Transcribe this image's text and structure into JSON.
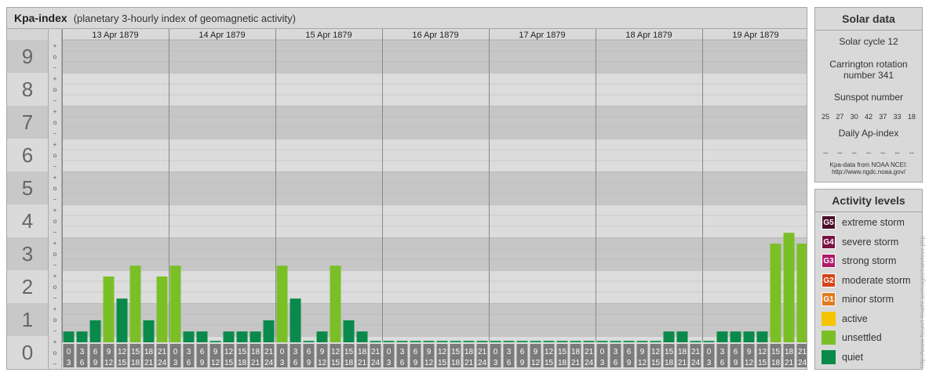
{
  "header": {
    "title": "Kpa-index",
    "subtitle": "(planetary 3-hourly index of geomagnetic activity)"
  },
  "chart_data": {
    "type": "bar",
    "title": "Kpa-index",
    "y_levels": [
      "0",
      "1",
      "2",
      "3",
      "4",
      "5",
      "6",
      "7",
      "8",
      "9"
    ],
    "y_sublevels": [
      "+",
      "o",
      "−"
    ],
    "ylim": [
      0,
      9
    ],
    "days": [
      "13 Apr 1879",
      "14 Apr 1879",
      "15 Apr 1879",
      "16 Apr 1879",
      "17 Apr 1879",
      "18 Apr 1879",
      "19 Apr 1879"
    ],
    "hour_start": [
      "0",
      "3",
      "6",
      "9",
      "12",
      "15",
      "18",
      "21"
    ],
    "hour_end": [
      "3",
      "6",
      "9",
      "12",
      "15",
      "18",
      "21",
      "24"
    ],
    "values": [
      [
        0.33,
        0.33,
        0.67,
        2.0,
        1.33,
        2.33,
        0.67,
        2.0
      ],
      [
        2.33,
        0.33,
        0.33,
        0.0,
        0.33,
        0.33,
        0.33,
        0.67
      ],
      [
        2.33,
        1.33,
        0.0,
        0.33,
        2.33,
        0.67,
        0.33,
        0.0
      ],
      [
        0.0,
        0.0,
        0.0,
        0.0,
        0.0,
        0.0,
        0.0,
        0.0
      ],
      [
        0.0,
        0.0,
        0.0,
        0.0,
        0.0,
        0.0,
        0.0,
        0.0
      ],
      [
        0.0,
        0.0,
        0.0,
        0.0,
        0.0,
        0.33,
        0.33,
        0.0
      ],
      [
        0.0,
        0.33,
        0.33,
        0.33,
        0.33,
        3.0,
        3.33,
        3.0
      ]
    ],
    "colors": {
      "quiet": "#0a8a4a",
      "unsettled": "#7bbf27",
      "zero": "#1f9b57"
    }
  },
  "solar": {
    "heading": "Solar data",
    "cycle": "Solar cycle 12",
    "carrington_line1": "Carrington rotation",
    "carrington_line2": "number 341",
    "sunspot_label": "Sunspot number",
    "sunspots": [
      "25",
      "27",
      "30",
      "42",
      "37",
      "33",
      "18"
    ],
    "ap_label": "Daily Ap-index",
    "ap_values": [
      "--",
      "--",
      "--",
      "--",
      "--",
      "--",
      "--"
    ],
    "credit_line1": "Kpa-data from NOAA NCEI:",
    "credit_line2": "http://www.ngdc.noaa.gov/"
  },
  "activity": {
    "heading": "Activity levels",
    "levels": [
      {
        "badge": "G5",
        "label": "extreme storm",
        "color": "#4d0f2a"
      },
      {
        "badge": "G4",
        "label": "severe storm",
        "color": "#7a1446"
      },
      {
        "badge": "G3",
        "label": "strong storm",
        "color": "#b0196a"
      },
      {
        "badge": "G2",
        "label": "moderate storm",
        "color": "#d64319"
      },
      {
        "badge": "G1",
        "label": "minor storm",
        "color": "#e07b1c"
      },
      {
        "badge": "",
        "label": "active",
        "color": "#f5c400"
      },
      {
        "badge": "",
        "label": "unsettled",
        "color": "#7bbf27"
      },
      {
        "badge": "",
        "label": "quiet",
        "color": "#0a8a4a"
      }
    ]
  },
  "watermark": "http://www.fleuret-feucht.se/magnet/archive.php"
}
